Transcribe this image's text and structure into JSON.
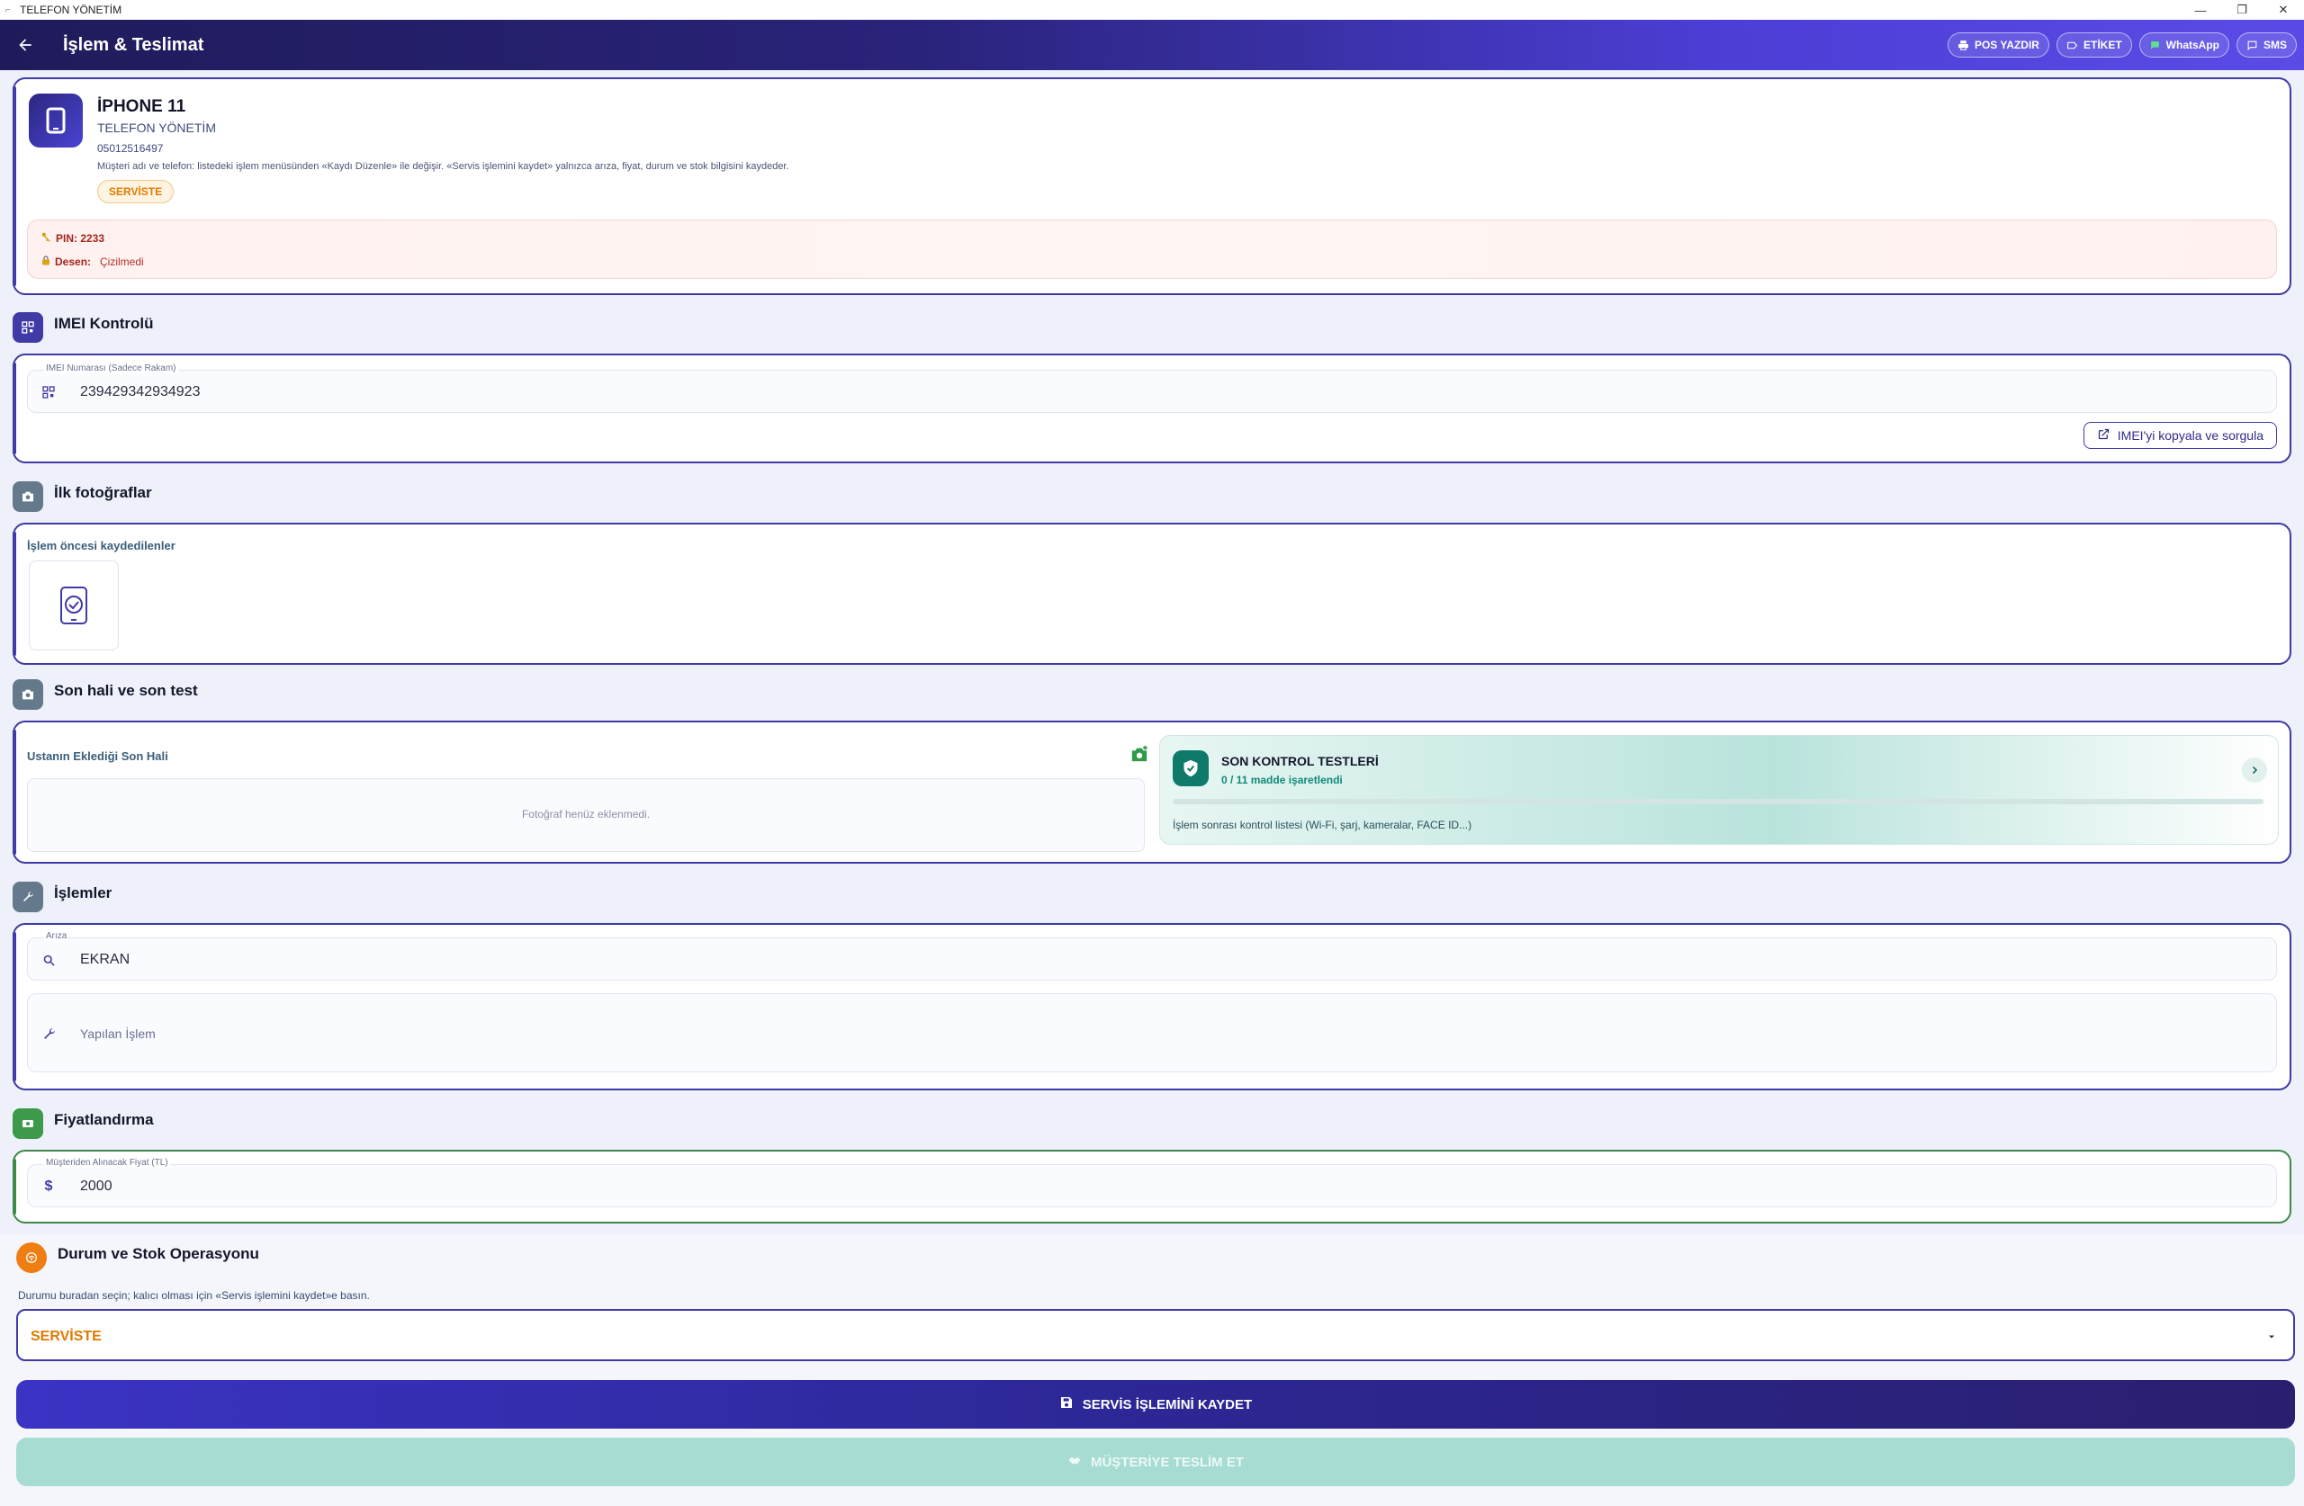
{
  "window": {
    "title": "TELEFON YÖNETİM",
    "controls": [
      "—",
      "❐",
      "✕"
    ]
  },
  "appbar": {
    "title": "İşlem & Teslimat",
    "actions": [
      {
        "label": "POS YAZDIR",
        "icon": "printer-icon"
      },
      {
        "label": "ETİKET",
        "icon": "label-icon"
      },
      {
        "label": "WhatsApp",
        "icon": "whatsapp-icon"
      },
      {
        "label": "SMS",
        "icon": "sms-icon"
      }
    ]
  },
  "device": {
    "name": "İPHONE 11",
    "owner": "TELEFON YÖNETİM",
    "phone": "05012516497",
    "note": "Müşteri adı ve telefon: listedeki işlem menüsünden «Kaydı Düzenle» ile değişir. «Servis işlemini kaydet» yalnızca arıza, fiyat, durum ve stok bilgisini kaydeder.",
    "status_badge": "SERVİSTE",
    "pin_label": "PIN: 2233",
    "pattern_label": "Desen:",
    "pattern_value": "Çizilmedi"
  },
  "imei": {
    "section_title": "IMEI Kontrolü",
    "field_label": "IMEI Numarası (Sadece Rakam)",
    "value": "239429342934923",
    "copy_button": "IMEI'yi kopyala ve sorgula"
  },
  "photos": {
    "section_title": "İlk fotoğraflar",
    "sub_label": "İşlem öncesi kaydedilenler"
  },
  "final": {
    "section_title": "Son hali ve son test",
    "sub_label": "Ustanın Eklediği Son Hali",
    "empty_text": "Fotoğraf henüz eklenmedi.",
    "tests_title": "SON KONTROL TESTLERİ",
    "tests_count": "0 / 11 madde işaretlendi",
    "tests_progress": 0,
    "tests_desc": "İşlem sonrası kontrol listesi (Wi-Fi, şarj, kameralar, FACE ID...)"
  },
  "operations": {
    "section_title": "İşlemler",
    "fault_label": "Arıza",
    "fault_value": "EKRAN",
    "work_placeholder": "Yapılan İşlem"
  },
  "pricing": {
    "section_title": "Fiyatlandırma",
    "field_label": "Müşteriden Alınacak Fiyat (TL)",
    "value": "2000"
  },
  "status": {
    "section_title": "Durum ve Stok Operasyonu",
    "hint": "Durumu buradan seçin; kalıcı olması için «Servis işlemini kaydet»e basın.",
    "selected": "SERVİSTE"
  },
  "buttons": {
    "save": "SERVİS İŞLEMİNİ KAYDET",
    "deliver": "MÜŞTERİYE TESLİM ET"
  },
  "colors": {
    "primary": "#3f3aa6",
    "accent_orange": "#e07b00",
    "teal": "#0f7a6a",
    "green": "#3c8a4a"
  }
}
